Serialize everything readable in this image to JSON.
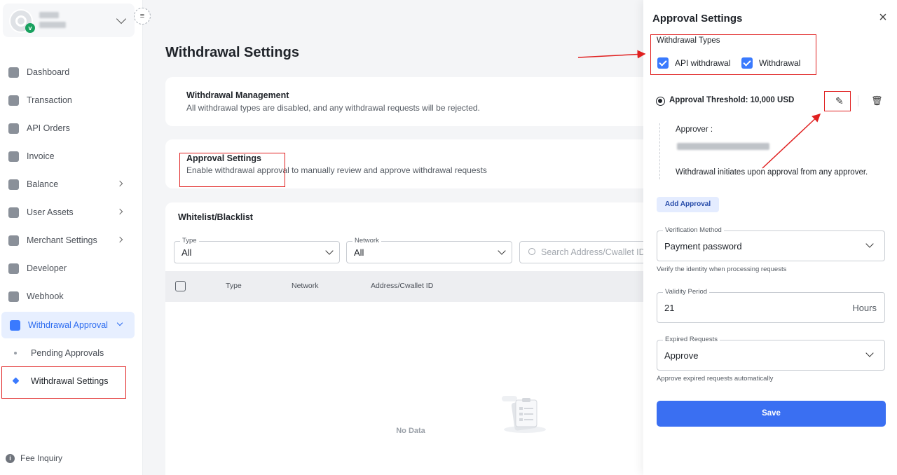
{
  "sidebar": {
    "items": [
      {
        "label": "Dashboard",
        "icon": "dashboard-icon"
      },
      {
        "label": "Transaction",
        "icon": "transaction-icon"
      },
      {
        "label": "API Orders",
        "icon": "api-orders-icon"
      },
      {
        "label": "Invoice",
        "icon": "invoice-icon"
      },
      {
        "label": "Balance",
        "icon": "balance-icon"
      },
      {
        "label": "User Assets",
        "icon": "user-assets-icon"
      },
      {
        "label": "Merchant Settings",
        "icon": "merchant-settings-icon"
      },
      {
        "label": "Developer",
        "icon": "developer-icon"
      },
      {
        "label": "Webhook",
        "icon": "webhook-icon"
      },
      {
        "label": "Withdrawal Approval",
        "icon": "withdrawal-approval-icon"
      }
    ],
    "sub_items": [
      {
        "label": "Pending Approvals"
      },
      {
        "label": "Withdrawal Settings"
      }
    ],
    "fee_inquiry": "Fee Inquiry",
    "accent": "#3a7afe"
  },
  "main": {
    "title": "Withdrawal Settings",
    "management": {
      "title": "Withdrawal Management",
      "desc": "All withdrawal types are disabled, and any withdrawal requests will be rejected."
    },
    "approval": {
      "title": "Approval Settings",
      "desc": "Enable withdrawal approval to manually review and approve withdrawal requests"
    },
    "whitelist": {
      "title": "Whitelist/Blacklist",
      "type_label": "Type",
      "type_value": "All",
      "network_label": "Network",
      "network_value": "All",
      "search_placeholder": "Search Address/Cwallet ID",
      "columns": [
        "Type",
        "Network",
        "Address/Cwallet ID"
      ],
      "empty": "No Data"
    }
  },
  "panel": {
    "title": "Approval Settings",
    "withdrawal_types_label": "Withdrawal Types",
    "types": [
      "API withdrawal",
      "Withdrawal"
    ],
    "threshold": "Approval Threshold: 10,000 USD",
    "approver_label": "Approver :",
    "approver_desc": "Withdrawal initiates upon approval from any approver.",
    "add_approval": "Add Approval",
    "verification": {
      "label": "Verification Method",
      "value": "Payment password",
      "hint": "Verify the identity when processing requests"
    },
    "validity": {
      "label": "Validity Period",
      "value": "21",
      "unit": "Hours"
    },
    "expired": {
      "label": "Expired Requests",
      "value": "Approve",
      "hint": "Approve expired requests automatically"
    },
    "save": "Save",
    "primary_color": "#3a6ff2"
  }
}
